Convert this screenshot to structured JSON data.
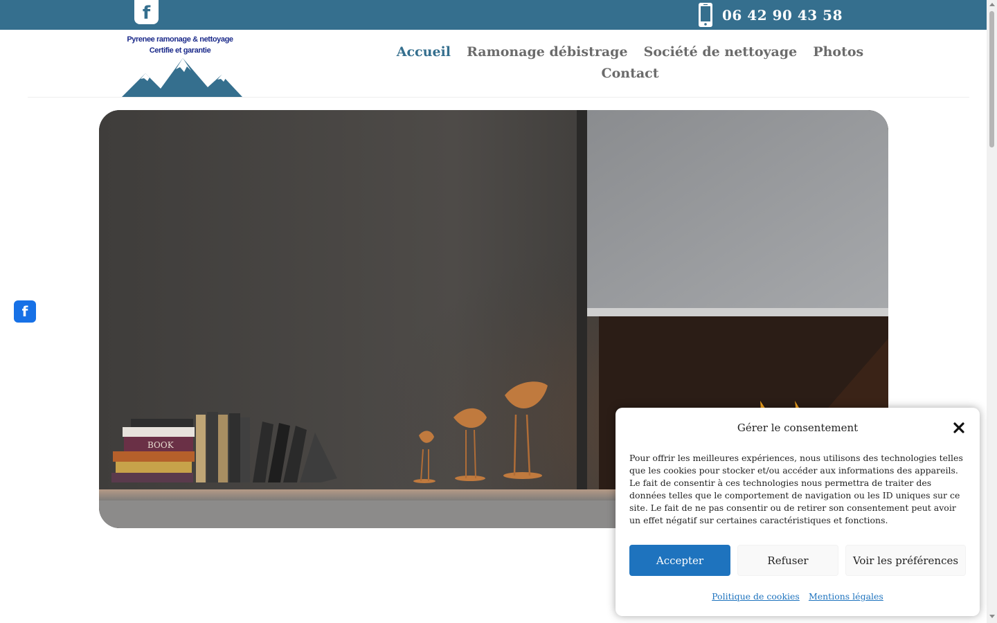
{
  "topbar": {
    "facebook_glyph": "f",
    "phone_number": "06 42 90 43 58",
    "background_color": "#356f8e"
  },
  "logo": {
    "line1": "Pyrenee ramonage & nettoyage",
    "line2": "Certifie et garantie"
  },
  "nav": {
    "items": [
      {
        "label": "Accueil",
        "active": true
      },
      {
        "label": "Ramonage débistrage"
      },
      {
        "label": "Société de nettoyage"
      },
      {
        "label": "Photos"
      },
      {
        "label": "Contact"
      }
    ],
    "active_color": "#356f8e"
  },
  "hero": {
    "book_spine_label": "BOOK"
  },
  "side_social": {
    "facebook_glyph": "f",
    "color": "#1771e6"
  },
  "consent": {
    "title": "Gérer le consentement",
    "text": "Pour offrir les meilleures expériences, nous utilisons des technologies telles que les cookies pour stocker et/ou accéder aux informations des appareils. Le fait de consentir à ces technologies nous permettra de traiter des données telles que le comportement de navigation ou les ID uniques sur ce site. Le fait de ne pas consentir ou de retirer son consentement peut avoir un effet négatif sur certaines caractéristiques et fonctions.",
    "accept_label": "Accepter",
    "refuse_label": "Refuser",
    "preferences_label": "Voir les préférences",
    "cookie_policy_link": "Politique de cookies",
    "legal_link": "Mentions légales",
    "accent_color": "#1e73be"
  }
}
